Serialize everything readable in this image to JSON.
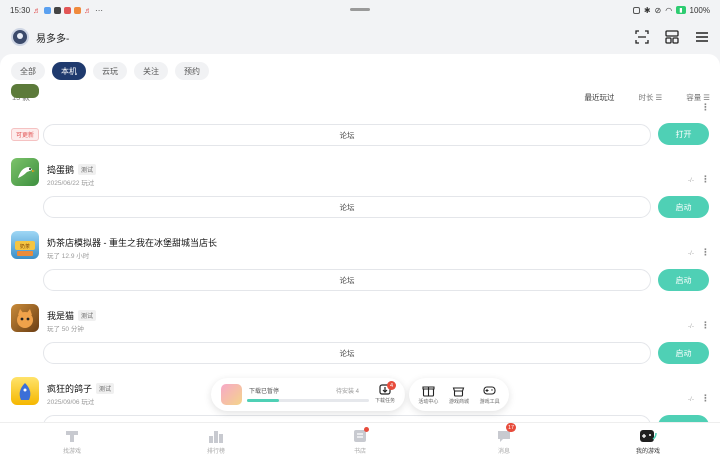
{
  "status": {
    "time": "15:30",
    "battery": "100%"
  },
  "user": {
    "name": "易多多-"
  },
  "tabs": [
    {
      "label": "全部",
      "active": false
    },
    {
      "label": "本机",
      "active": true
    },
    {
      "label": "云玩",
      "active": false
    },
    {
      "label": "关注",
      "active": false
    },
    {
      "label": "预约",
      "active": false
    }
  ],
  "list": {
    "count_label": "15 款",
    "sorts": [
      "最近玩过",
      "时长",
      "容量"
    ]
  },
  "partial_game": {
    "tag": "可更新",
    "forum": "论坛",
    "action": "打开"
  },
  "games": [
    {
      "title": "捣蛋鹅",
      "tag": "测试",
      "sub": "2025/06/22 玩过",
      "dash": "-/-",
      "forum": "论坛",
      "action": "启动"
    },
    {
      "title": "奶茶店模拟器 - 重生之我在冰堡甜城当店长",
      "tag": "",
      "sub": "玩了 12.9 小时",
      "dash": "-/-",
      "forum": "论坛",
      "action": "启动"
    },
    {
      "title": "我是猫",
      "tag": "测试",
      "sub": "玩了 50 分钟",
      "dash": "-/-",
      "forum": "论坛",
      "action": "启动"
    },
    {
      "title": "疯狂的鸽子",
      "tag": "测试",
      "sub": "2025/09/06 玩过",
      "dash": "-/-",
      "forum": "论坛",
      "action": "启动"
    }
  ],
  "download": {
    "name": "下载已暂停",
    "status": "待安装 4",
    "progress": 0.26,
    "label": "下载任务",
    "badge": "4"
  },
  "tools": [
    "活动中心",
    "游戏商城",
    "游戏工具"
  ],
  "nav": [
    {
      "label": "找游戏",
      "active": false
    },
    {
      "label": "排行榜",
      "active": false
    },
    {
      "label": "书店",
      "active": false
    },
    {
      "label": "消息",
      "active": false,
      "badge": "17"
    },
    {
      "label": "我的游戏",
      "active": true
    }
  ],
  "colors": {
    "accent": "#4fd0b5",
    "active_chip": "#1f3a6e",
    "badge": "#e74c3c"
  }
}
